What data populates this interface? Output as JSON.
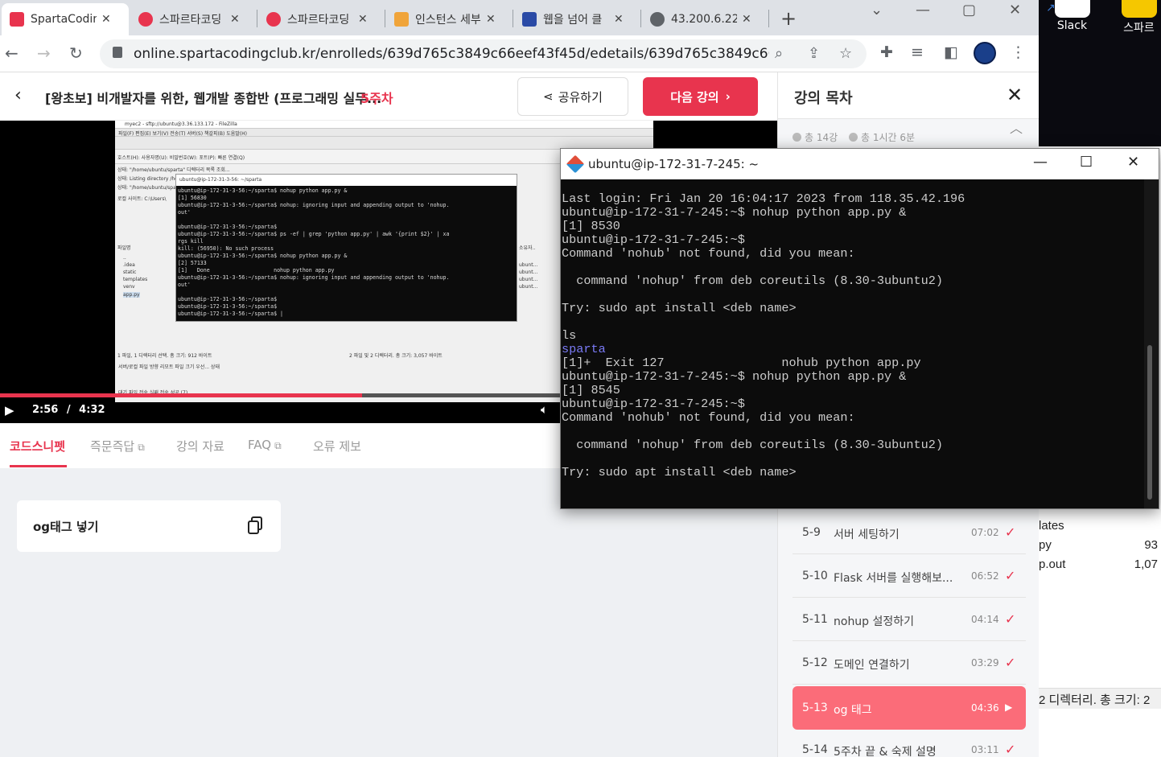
{
  "desktop": {
    "icons": [
      {
        "label": "Slack"
      },
      {
        "label": "스파르"
      }
    ],
    "explorer": {
      "rows": [
        {
          "name": "lates",
          "size": ""
        },
        {
          "name": "py",
          "size": "93"
        },
        {
          "name": "p.out",
          "size": "1,07"
        }
      ],
      "status": "2 디렉터리. 총 크기: 2"
    }
  },
  "browser": {
    "tabs": [
      {
        "title": "SpartaCodin",
        "favicon_color": "#e8344e",
        "active": true
      },
      {
        "title": "스파르타코딩",
        "favicon_color": "#e8344e",
        "active": false
      },
      {
        "title": "스파르타코딩",
        "favicon_color": "#e8344e",
        "active": false
      },
      {
        "title": "인스턴스 세부",
        "favicon_color": "#f0a43a",
        "active": false
      },
      {
        "title": "웹을 넘어 클",
        "favicon_color": "#2a4aa6",
        "active": false
      },
      {
        "title": "43.200.6.22",
        "favicon_color": "#5f6368",
        "active": false
      }
    ],
    "close_glyph": "✕",
    "new_tab_glyph": "+",
    "url": "online.spartacodingclub.kr/enrolleds/639d765c3849c66eef43f45d/edetails/639d765c3849c66eef4..."
  },
  "header": {
    "course_title": "[왕초보] 비개발자를 위한, 웹개발 종합반 (프로그래밍 실무...",
    "week_label": "5주차",
    "share_label": "공유하기",
    "next_label": "다음 강의"
  },
  "video": {
    "current_time": "2:56",
    "separator": "/",
    "duration": "4:32",
    "progress": 0.647,
    "embedded": {
      "title": "myec2 - sftp://ubuntu@3.36.133.172 - FileZilla",
      "menu": "파일(F)  편집(E)  보기(V)  전송(T)  서버(S)  책갈피(B)  도움말(H)",
      "quickconnect": "호스트(H):              사용자명(U):              비밀번호(W):              포트(P):        빠른 연결(Q)",
      "status_lines": [
        "상태:   \"/home/ubuntu/sparta\" 디렉터리 목록 조회...",
        "상태:   Listing directory /home/ubuntu/sparta",
        "상태:   \"/home/ubuntu/sparta\" 디렉터리 목록 조회 성공"
      ],
      "local_site": "로컬 사이트:  C:\\Users\\",
      "local_files": [
        "..",
        ".idea",
        "static",
        "templates",
        "venv",
        "app.py"
      ],
      "file_header": "파일명",
      "remote_header": "소유자..",
      "remote_owners": [
        "ubunt...",
        "ubunt...",
        "ubunt...",
        "ubunt..."
      ],
      "local_status": "1 파일, 1 디렉터리 선택. 총 크기: 912 바이트",
      "remote_status": "2 파일 및 2 디렉터리. 총 크기: 3,057 바이트",
      "queue_header": "서버/로컬 파일        방향    리모트 파일                크기  우선...  상태",
      "queue_tabs": "대기 파일   전송 실패   전송 성공 (7)",
      "term_title": "ubuntu@ip-172-31-3-56: ~/sparta",
      "term_lines": [
        "ubuntu@ip-172-31-3-56:~/sparta$ nohup python app.py &",
        "[1] 56830",
        "ubuntu@ip-172-31-3-56:~/sparta$ nohup: ignoring input and appending output to 'nohup.",
        "out'",
        "",
        "ubuntu@ip-172-31-3-56:~/sparta$",
        "ubuntu@ip-172-31-3-56:~/sparta$ ps -ef | grep 'python app.py' | awk '{print $2}' | xa",
        "rgs kill",
        "kill: (56950): No such process",
        "ubuntu@ip-172-31-3-56:~/sparta$ nohup python app.py &",
        "[2] 57133",
        "[1]   Done                    nohup python app.py",
        "ubuntu@ip-172-31-3-56:~/sparta$ nohup: ignoring input and appending output to 'nohup.",
        "out'",
        "",
        "ubuntu@ip-172-31-3-56:~/sparta$",
        "ubuntu@ip-172-31-3-56:~/sparta$",
        "ubuntu@ip-172-31-3-56:~/sparta$ |"
      ]
    }
  },
  "lecture_tabs": [
    {
      "label": "코드스니펫",
      "external": false,
      "active": true
    },
    {
      "label": "즉문즉답",
      "external": true,
      "active": false
    },
    {
      "label": "강의 자료",
      "external": false,
      "active": false
    },
    {
      "label": "FAQ",
      "external": true,
      "active": false
    },
    {
      "label": "오류 제보",
      "external": false,
      "active": false
    }
  ],
  "snippet": {
    "title": "og태그 넣기"
  },
  "curriculum": {
    "title": "강의 목차",
    "week_lessons_count": "총 14강",
    "week_duration": "총 1시간 6분",
    "lessons": [
      {
        "num": "5-9",
        "title": "서버 세팅하기",
        "duration": "07:02",
        "current": false
      },
      {
        "num": "5-10",
        "title": "Flask 서버를 실행해보...",
        "duration": "06:52",
        "current": false
      },
      {
        "num": "5-11",
        "title": "nohup 설정하기",
        "duration": "04:14",
        "current": false
      },
      {
        "num": "5-12",
        "title": "도메인 연결하기",
        "duration": "03:29",
        "current": false
      },
      {
        "num": "5-13",
        "title": "og 태그",
        "duration": "04:36",
        "current": true
      },
      {
        "num": "5-14",
        "title": "5주차 끝 & 숙제 설명",
        "duration": "03:11",
        "current": false
      }
    ]
  },
  "terminal": {
    "title": "ubuntu@ip-172-31-7-245: ~",
    "lines": [
      "Last login: Fri Jan 20 16:04:17 2023 from 118.35.42.196",
      "ubuntu@ip-172-31-7-245:~$ nohup python app.py &",
      "[1] 8530",
      "ubuntu@ip-172-31-7-245:~$",
      "Command 'nohub' not found, did you mean:",
      "",
      "  command 'nohup' from deb coreutils (8.30-3ubuntu2)",
      "",
      "Try: sudo apt install <deb name>",
      "",
      "ls",
      "sparta",
      "[1]+  Exit 127                nohub python app.py",
      "ubuntu@ip-172-31-7-245:~$ nohup python app.py &",
      "[1] 8545",
      "ubuntu@ip-172-31-7-245:~$",
      "Command 'nohub' not found, did you mean:",
      "",
      "  command 'nohup' from deb coreutils (8.30-3ubuntu2)",
      "",
      "Try: sudo apt install <deb name>"
    ],
    "highlight_line": 11,
    "highlight_color": "#7a7af5"
  }
}
